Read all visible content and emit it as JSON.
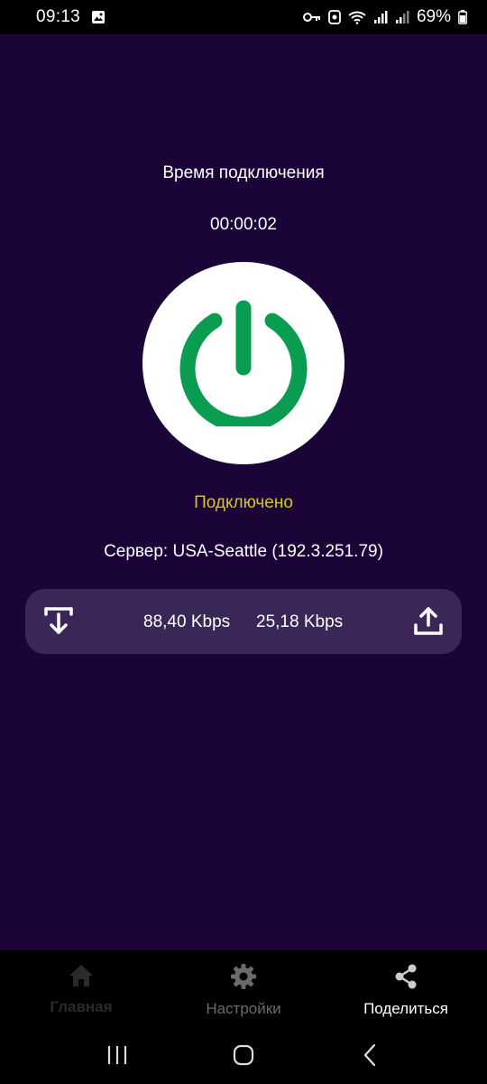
{
  "status_bar": {
    "time": "09:13",
    "battery": "69%",
    "icons": [
      "image-icon",
      "key-icon",
      "vpn-icon",
      "wifi-icon",
      "signal-icon",
      "signal-icon",
      "battery-icon"
    ]
  },
  "main": {
    "connection_time_label": "Время подключения",
    "connection_timer": "00:00:02",
    "power_button_icon": "power-icon",
    "power_color": "#0a9d52",
    "status": "Подключено",
    "status_color": "#d4c428",
    "server": "Сервер: USA-Seattle (192.3.251.79)"
  },
  "speed": {
    "download": "88,40 Kbps",
    "upload": "25,18 Kbps",
    "download_icon": "download-icon",
    "upload_icon": "upload-icon"
  },
  "bottom_nav": {
    "items": [
      {
        "label": "Главная",
        "icon": "home-icon"
      },
      {
        "label": "Настройки",
        "icon": "gear-icon"
      },
      {
        "label": "Поделиться",
        "icon": "share-icon"
      }
    ]
  },
  "colors": {
    "background": "#1b0538",
    "panel": "#3a2757",
    "accent_green": "#0a9d52"
  }
}
